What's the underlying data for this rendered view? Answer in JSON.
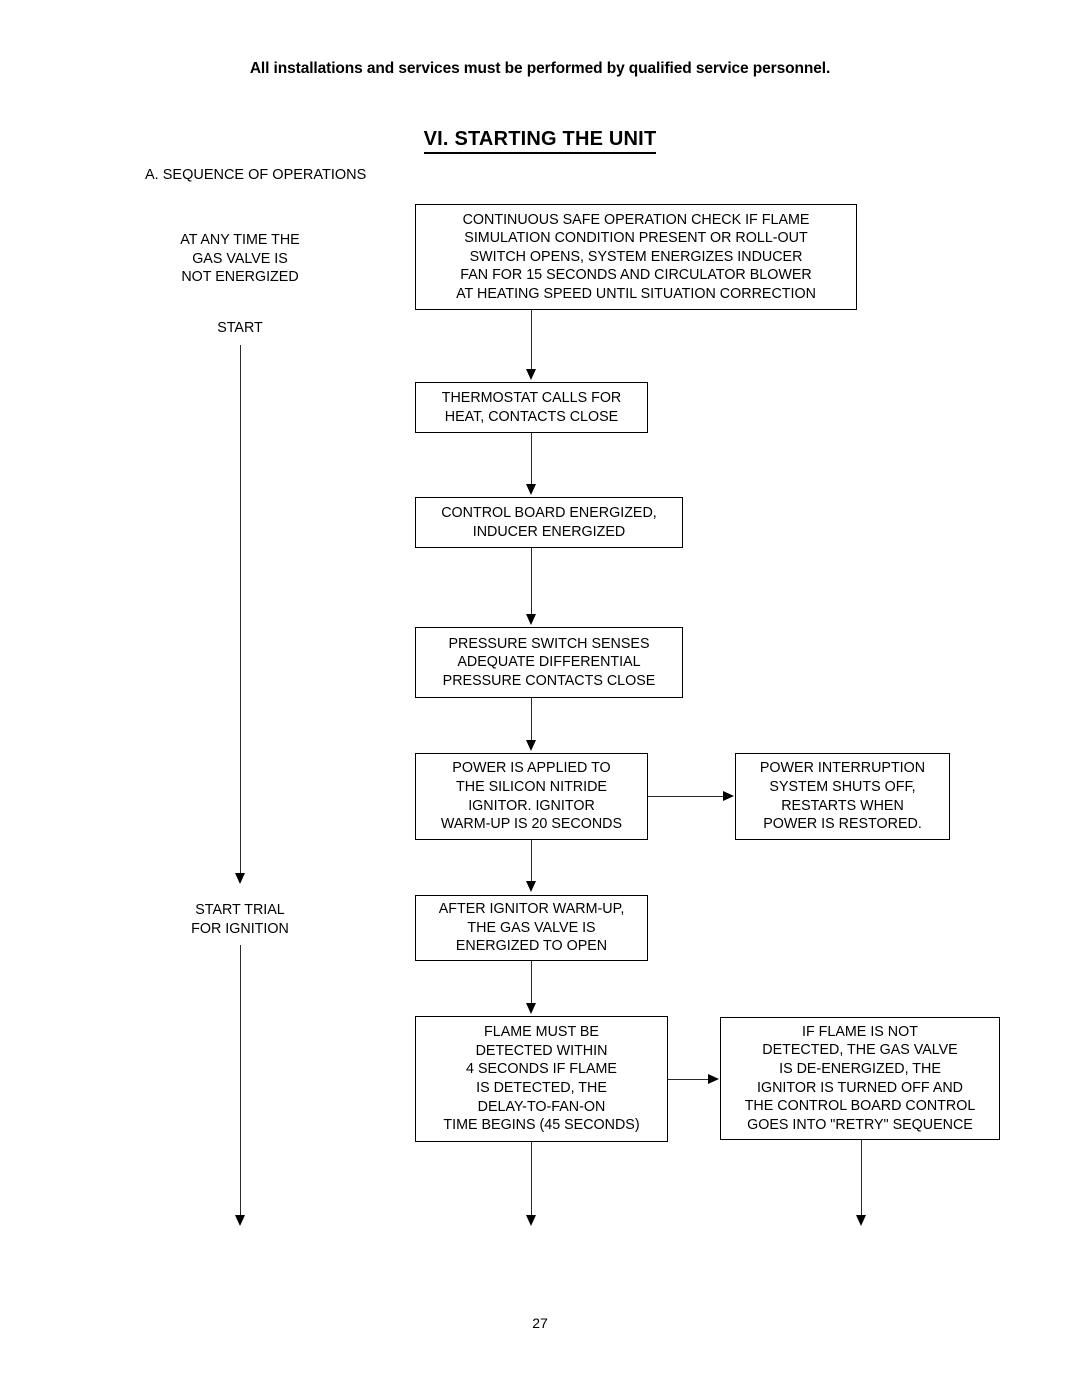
{
  "header": {
    "banner": "All installations and services must be performed by qualified service personnel.",
    "title": "VI.  STARTING THE UNIT",
    "section_label": "A. SEQUENCE OF OPERATIONS"
  },
  "side_labels": {
    "gas_valve": [
      "AT ANY TIME THE",
      "GAS VALVE IS",
      "NOT ENERGIZED"
    ],
    "start": [
      "START"
    ],
    "start_trial": [
      "START TRIAL",
      "FOR IGNITION"
    ]
  },
  "boxes": {
    "continuous_safe": [
      "CONTINUOUS SAFE OPERATION CHECK IF FLAME",
      "SIMULATION CONDITION PRESENT OR ROLL-OUT",
      "SWITCH OPENS, SYSTEM ENERGIZES INDUCER",
      "FAN FOR 15 SECONDS AND CIRCULATOR BLOWER",
      "AT HEATING SPEED UNTIL SITUATION CORRECTION"
    ],
    "thermostat": [
      "THERMOSTAT CALLS FOR",
      "HEAT, CONTACTS CLOSE"
    ],
    "control_board": [
      "CONTROL BOARD ENERGIZED,",
      "INDUCER ENERGIZED"
    ],
    "pressure_switch": [
      "PRESSURE SWITCH SENSES",
      "ADEQUATE DIFFERENTIAL",
      "PRESSURE CONTACTS CLOSE"
    ],
    "power_applied": [
      "POWER IS APPLIED TO",
      "THE SILICON NITRIDE",
      "IGNITOR.  IGNITOR",
      "WARM-UP IS 20 SECONDS"
    ],
    "power_interruption": [
      "POWER INTERRUPTION",
      "SYSTEM SHUTS OFF,",
      "RESTARTS WHEN",
      "POWER IS RESTORED."
    ],
    "after_ignitor": [
      "AFTER IGNITOR WARM-UP,",
      "THE GAS VALVE IS",
      "ENERGIZED TO OPEN"
    ],
    "flame_detected": [
      "FLAME MUST BE",
      "DETECTED WITHIN",
      "4 SECONDS IF FLAME",
      "IS DETECTED, THE",
      "DELAY-TO-FAN-ON",
      "TIME BEGINS (45 SECONDS)"
    ],
    "flame_not_detected": [
      "IF FLAME IS NOT",
      "DETECTED, THE GAS VALVE",
      "IS DE-ENERGIZED, THE",
      "IGNITOR IS TURNED OFF AND",
      "THE CONTROL BOARD CONTROL",
      "GOES INTO \"RETRY\" SEQUENCE"
    ]
  },
  "footer": {
    "page_number": "27"
  },
  "colors": {
    "text": "#000000",
    "line": "#2b2b2b",
    "background": "#ffffff"
  }
}
